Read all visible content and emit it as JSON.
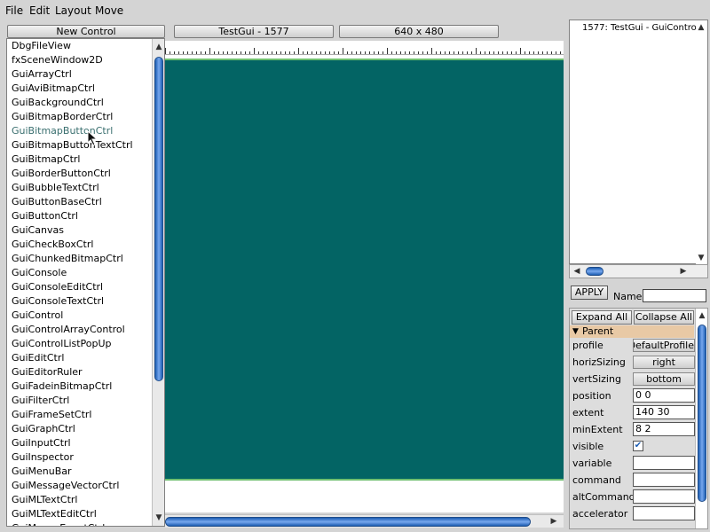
{
  "menu": [
    "File",
    "Edit",
    "Layout",
    "Move"
  ],
  "header": {
    "new_control": "New Control",
    "gui_name": "TestGui - 1577",
    "resolution": "640 x 480"
  },
  "control_list": {
    "highlighted_index": 6,
    "items": [
      "DbgFileView",
      "fxSceneWindow2D",
      "GuiArrayCtrl",
      "GuiAviBitmapCtrl",
      "GuiBackgroundCtrl",
      "GuiBitmapBorderCtrl",
      "GuiBitmapButtonCtrl",
      "GuiBitmapButtonTextCtrl",
      "GuiBitmapCtrl",
      "GuiBorderButtonCtrl",
      "GuiBubbleTextCtrl",
      "GuiButtonBaseCtrl",
      "GuiButtonCtrl",
      "GuiCanvas",
      "GuiCheckBoxCtrl",
      "GuiChunkedBitmapCtrl",
      "GuiConsole",
      "GuiConsoleEditCtrl",
      "GuiConsoleTextCtrl",
      "GuiControl",
      "GuiControlArrayControl",
      "GuiControlListPopUp",
      "GuiEditCtrl",
      "GuiEditorRuler",
      "GuiFadeinBitmapCtrl",
      "GuiFilterCtrl",
      "GuiFrameSetCtrl",
      "GuiGraphCtrl",
      "GuiInputCtrl",
      "GuiInspector",
      "GuiMenuBar",
      "GuiMessageVectorCtrl",
      "GuiMLTextCtrl",
      "GuiMLTextEditCtrl",
      "GuiMouseEventCtrl"
    ]
  },
  "tree": {
    "item": "1577: TestGui - GuiContro"
  },
  "inspector": {
    "apply": "APPLY",
    "name_label": "Name:",
    "name_value": "",
    "expand_all": "Expand All",
    "collapse_all": "Collapse All",
    "group": "Parent",
    "properties": {
      "profile": {
        "label": "profile",
        "value": "GuiDefaultProfile"
      },
      "horizSizing": {
        "label": "horizSizing",
        "value": "right"
      },
      "vertSizing": {
        "label": "vertSizing",
        "value": "bottom"
      },
      "position": {
        "label": "position",
        "value": "0 0"
      },
      "extent": {
        "label": "extent",
        "value": "140 30"
      },
      "minExtent": {
        "label": "minExtent",
        "value": "8 2"
      },
      "visible": {
        "label": "visible",
        "checked": true
      },
      "variable": {
        "label": "variable",
        "value": ""
      },
      "command": {
        "label": "command",
        "value": ""
      },
      "altCommand": {
        "label": "altCommand",
        "value": ""
      },
      "accelerator": {
        "label": "accelerator",
        "value": ""
      }
    }
  },
  "colors": {
    "canvas_control": "#036464",
    "control_border": "#6fbf6f",
    "scroll_thumb": "#1d5eb3",
    "group_header": "#e8c9a5",
    "highlight_text": "#3a6f6f"
  }
}
